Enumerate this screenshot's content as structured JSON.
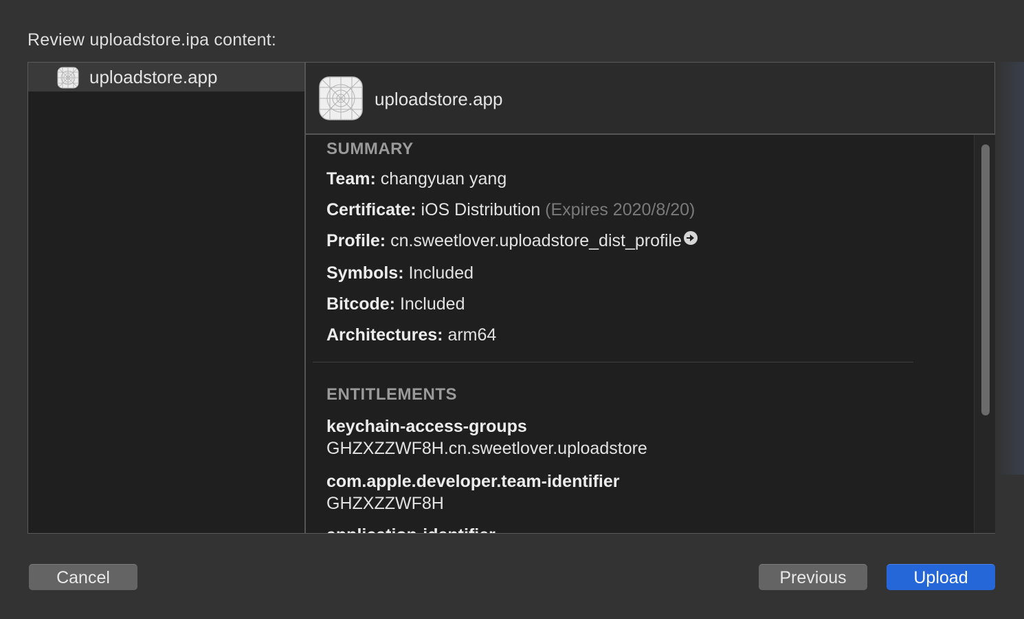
{
  "heading": "Review uploadstore.ipa content:",
  "sidebar": {
    "items": [
      {
        "label": "uploadstore.app",
        "icon": "app-icon"
      }
    ]
  },
  "detail": {
    "title": "uploadstore.app",
    "summary": {
      "section_label": "SUMMARY",
      "team_key": "Team:",
      "team_value": "changyuan yang",
      "certificate_key": "Certificate:",
      "certificate_value": "iOS Distribution",
      "certificate_expiry": "(Expires 2020/8/20)",
      "profile_key": "Profile:",
      "profile_value": "cn.sweetlover.uploadstore_dist_profile",
      "symbols_key": "Symbols:",
      "symbols_value": "Included",
      "bitcode_key": "Bitcode:",
      "bitcode_value": "Included",
      "architectures_key": "Architectures:",
      "architectures_value": "arm64"
    },
    "entitlements": {
      "section_label": "ENTITLEMENTS",
      "items": [
        {
          "key": "keychain-access-groups",
          "value": "GHZXZZWF8H.cn.sweetlover.uploadstore"
        },
        {
          "key": "com.apple.developer.team-identifier",
          "value": "GHZXZZWF8H"
        },
        {
          "key": "application-identifier",
          "value": ""
        }
      ]
    }
  },
  "buttons": {
    "cancel": "Cancel",
    "previous": "Previous",
    "upload": "Upload"
  },
  "colors": {
    "background": "#333333",
    "panel": "#1f1f1f",
    "primary_button": "#2566d9",
    "secondary_button": "#646464"
  }
}
